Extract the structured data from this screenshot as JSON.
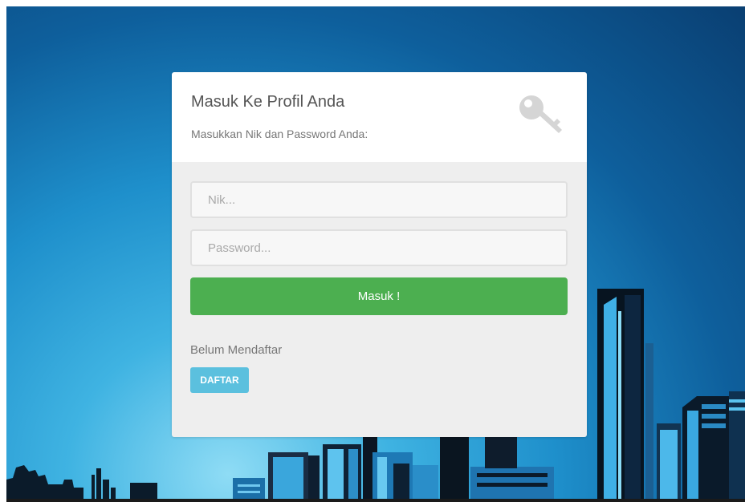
{
  "login": {
    "title": "Masuk Ke Profil Anda",
    "subtitle": "Masukkan Nik dan Password Anda:",
    "nik_placeholder": "Nik...",
    "password_placeholder": "Password...",
    "submit_label": "Masuk !",
    "register_prompt": "Belum Mendaftar",
    "register_label": "DAFTAR",
    "header_icon": "key-icon"
  },
  "colors": {
    "submit_button": "#4caf50",
    "register_button": "#5bc0de",
    "card_body": "#eeeeee",
    "card_header": "#ffffff",
    "background_sky": "#1e8fcb"
  }
}
